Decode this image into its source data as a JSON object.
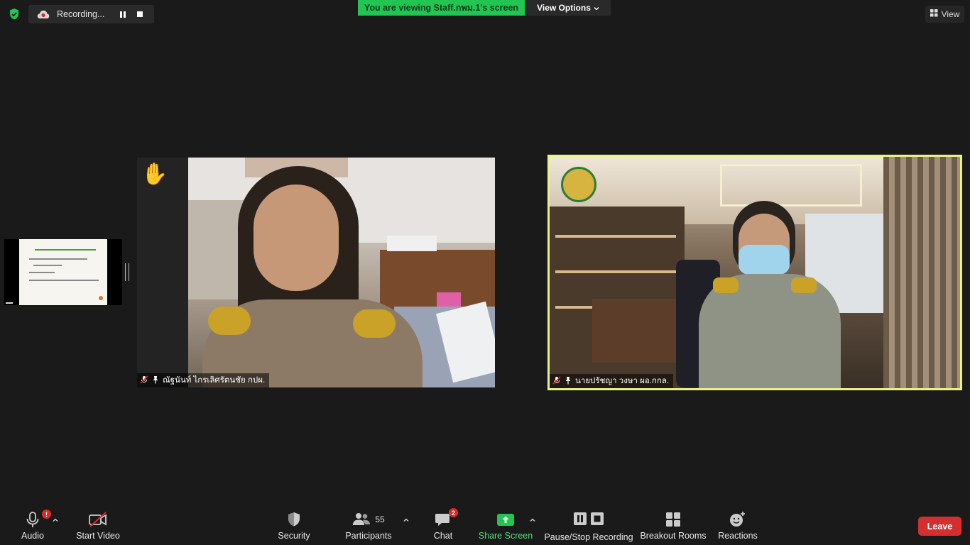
{
  "top_bar": {
    "recording_label": "Recording...",
    "viewing_banner": "You are viewing Staff.กพม.1's screen",
    "view_options_label": "View Options",
    "view_label": "View"
  },
  "shared_screen_thumbnail": {
    "slide_title": "หลักเกณฑ์การเป็นบุคลากร",
    "slide_lines": [
      "1. แผนที่ความก้าวหน้าในสายอาชีพ",
      "(Career Path)",
      "2. แผนสืบทอดตำแหน่ง",
      "3. ประกอบการพิจารณาเลื่อนตำแหน่ง"
    ]
  },
  "participants_tiles": [
    {
      "name": "ณัฐนันท์  ไกรเลิศรัตนชัย กปผ.",
      "muted": true,
      "pinned": true,
      "raised_hand": true
    },
    {
      "name": "นายปรัชญา วงษา ผอ.กกล.",
      "muted": true,
      "pinned": true,
      "active_speaker": true,
      "highlight_color": "#e9f28a"
    }
  ],
  "toolbar": {
    "audio_label": "Audio",
    "audio_alert": "!",
    "video_label": "Start Video",
    "security_label": "Security",
    "participants_label": "Participants",
    "participants_count": "55",
    "chat_label": "Chat",
    "chat_badge": "2",
    "share_label": "Share Screen",
    "recording_label": "Pause/Stop Recording",
    "breakout_label": "Breakout Rooms",
    "reactions_label": "Reactions",
    "leave_label": "Leave"
  },
  "colors": {
    "background": "#1a1a1a",
    "banner_green": "#23c552",
    "share_green": "#23c552",
    "leave_red": "#d32f2f",
    "badge_red": "#e02828"
  }
}
